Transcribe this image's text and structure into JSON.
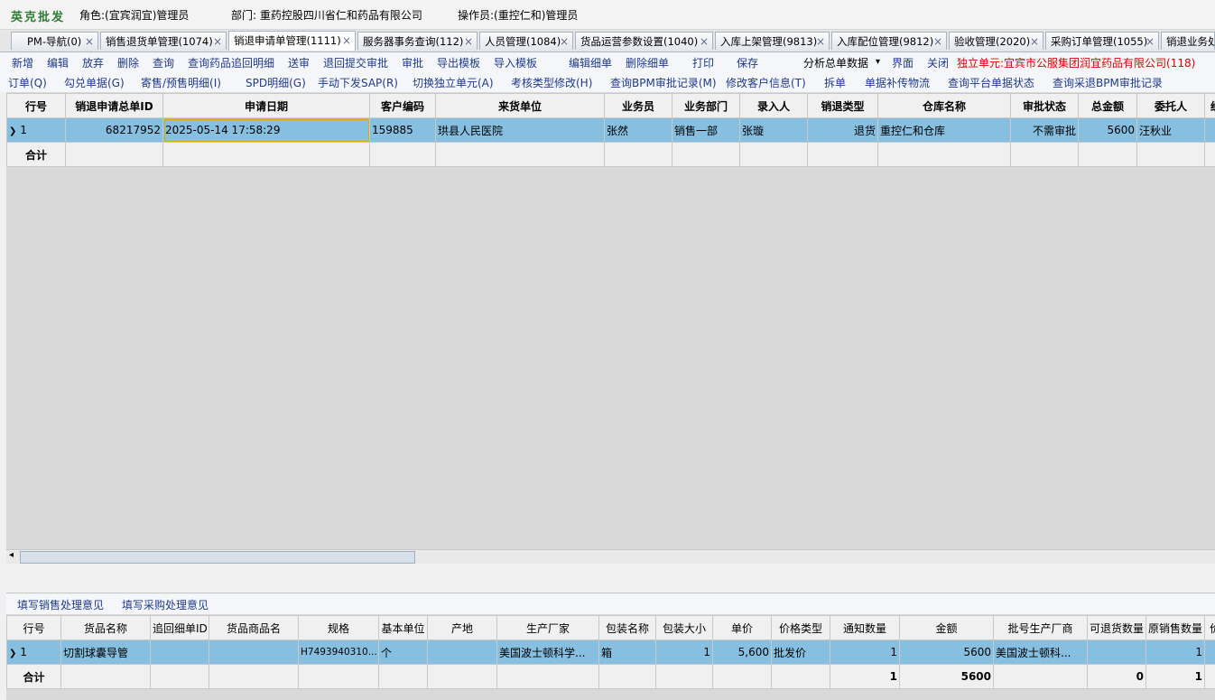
{
  "header": {
    "brand": "英克批发",
    "role": "角色:(宜宾润宜)管理员",
    "dept": "部门: 重药控股四川省仁和药品有限公司",
    "operator": "操作员:(重控仁和)管理员"
  },
  "tabs": [
    {
      "label": "PM-导航(0)"
    },
    {
      "label": "销售退货单管理(1074)"
    },
    {
      "label": "销退申请单管理(1111)"
    },
    {
      "label": "服务器事务查询(112)"
    },
    {
      "label": "人员管理(1084)"
    },
    {
      "label": "货品运营参数设置(1040)"
    },
    {
      "label": "入库上架管理(9813)"
    },
    {
      "label": "入库配位管理(9812)"
    },
    {
      "label": "验收管理(2020)"
    },
    {
      "label": "采购订单管理(1055)"
    },
    {
      "label": "销退业务处"
    }
  ],
  "close_glyph": "×",
  "toolbar1": {
    "items": [
      "新增",
      "编辑",
      "放弃",
      "删除",
      "查询",
      "查询药品追回明细",
      "送审",
      "退回提交审批",
      "审批",
      "导出模板",
      "导入模板",
      "编辑细单",
      "删除细单",
      "打印",
      "保存",
      "分析总单数据",
      "界面",
      "关闭"
    ],
    "dropdown_arrow": "▾",
    "unit_label": "独立单元:宜宾市公服集团润宜药品有限公司(118)"
  },
  "toolbar2": {
    "items": [
      "订单(Q)",
      "勾兑单据(G)",
      "寄售/预售明细(I)",
      "SPD明细(G)",
      "手动下发SAP(R)",
      "切换独立单元(A)",
      "考核类型修改(H)",
      "查询BPM审批记录(M)",
      "修改客户信息(T)",
      "拆单",
      "单据补传物流",
      "查询平台单据状态",
      "查询采退BPM审批记录"
    ]
  },
  "main_grid": {
    "columns": [
      "行号",
      "销退申请总单ID",
      "申请日期",
      "客户编码",
      "来货单位",
      "业务员",
      "业务部门",
      "录入人",
      "销退类型",
      "仓库名称",
      "审批状态",
      "总金额",
      "委托人",
      "经"
    ],
    "rows": [
      {
        "line": "1",
        "id": "68217952",
        "date": "2025-05-14 17:58:29",
        "cust_code": "159885",
        "supplier": "珙县人民医院",
        "salesman": "张然",
        "dept": "销售一部",
        "entry": "张璇",
        "type": "退货",
        "warehouse": "重控仁和仓库",
        "status": "不需审批",
        "amount": "5600",
        "client": "汪秋业",
        "last": ""
      }
    ],
    "total_label": "合计"
  },
  "subtoolbar": {
    "items": [
      "填写销售处理意见",
      "填写采购处理意见"
    ]
  },
  "detail_grid": {
    "columns": [
      "行号",
      "货品名称",
      "追回细单ID",
      "货品商品名",
      "规格",
      "基本单位",
      "产地",
      "生产厂家",
      "包装名称",
      "包装大小",
      "单价",
      "价格类型",
      "通知数量",
      "金额",
      "批号生产厂商",
      "可退货数量",
      "原销售数量",
      "价"
    ],
    "rows": [
      {
        "line": "1",
        "name": "切割球囊导管",
        "recall_id": "",
        "trade_name": "",
        "spec": "H7493940310...",
        "unit": "个",
        "origin": "",
        "maker": "美国波士顿科学...",
        "pack": "箱",
        "pack_size": "1",
        "price": "5,600",
        "price_type": "批发价",
        "notice_qty": "1",
        "amount": "5600",
        "lot_maker": "美国波士顿科...",
        "returnable": "",
        "orig_qty": "1",
        "last": ""
      }
    ],
    "totals": {
      "label": "合计",
      "notice_qty": "1",
      "amount": "5600",
      "returnable": "0",
      "orig_qty": "1"
    }
  },
  "colors": {
    "selected_row": "#87bfe0",
    "toolbar_text": "#1f3a8a",
    "brand": "#2e7d32",
    "unit_label": "#e00000"
  }
}
